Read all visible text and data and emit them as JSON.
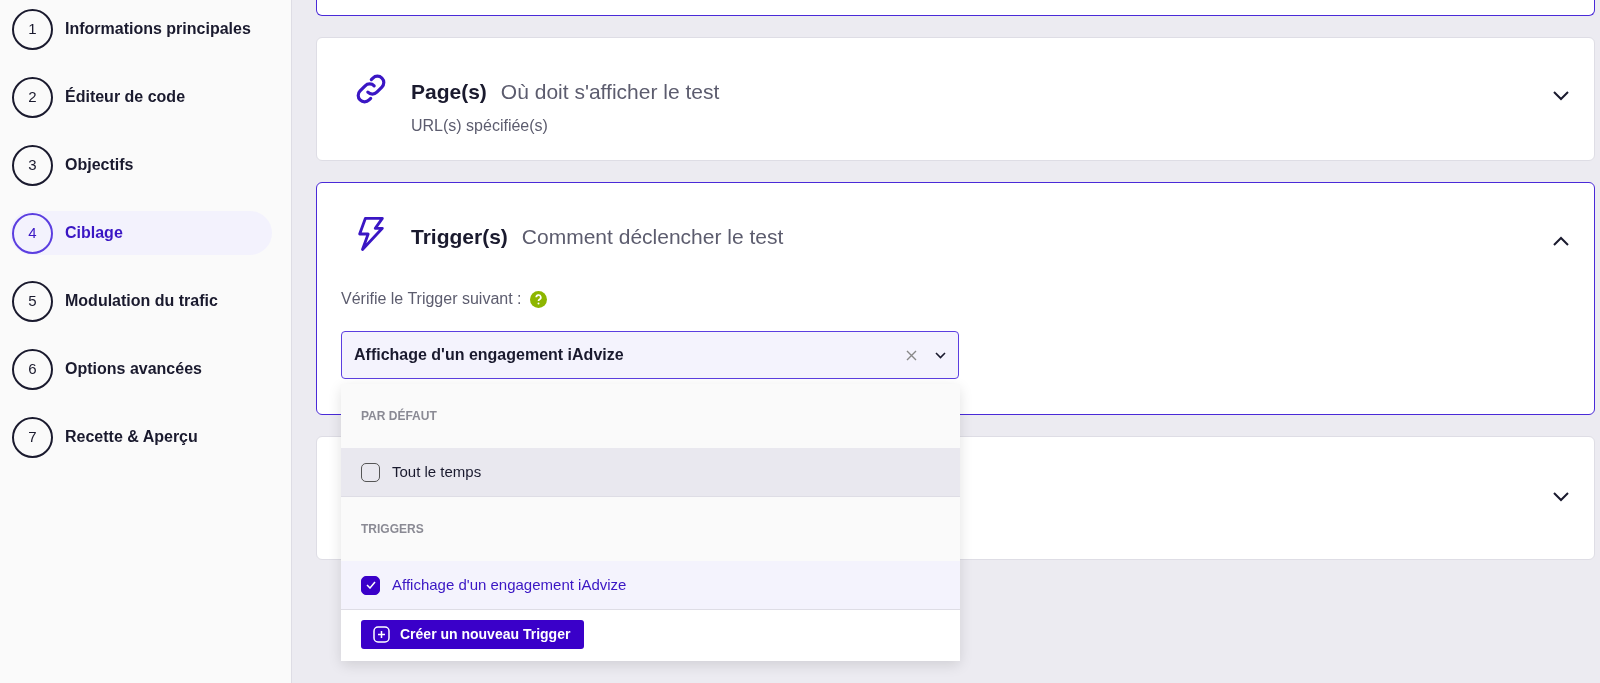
{
  "steps": [
    {
      "number": "1",
      "label": "Informations principales",
      "selected": false
    },
    {
      "number": "2",
      "label": "Éditeur de code",
      "selected": false
    },
    {
      "number": "3",
      "label": "Objectifs",
      "selected": false
    },
    {
      "number": "4",
      "label": "Ciblage",
      "selected": true
    },
    {
      "number": "5",
      "label": "Modulation du trafic",
      "selected": false
    },
    {
      "number": "6",
      "label": "Options avancées",
      "selected": false
    },
    {
      "number": "7",
      "label": "Recette & Aperçu",
      "selected": false
    }
  ],
  "sections": [
    {
      "kind": "link",
      "title": "Page(s)",
      "subtitle": "Où doit s'afficher le test",
      "description": "URL(s) spécifiée(s)",
      "expanded": false
    },
    {
      "kind": "bolt",
      "title": "Trigger(s)",
      "subtitle": "Comment déclencher le test",
      "expanded": true,
      "field_label": "Vérifie le Trigger suivant :",
      "select": {
        "value": "Affichage d'un engagement iAdvize",
        "groups": [
          {
            "heading": "PAR DÉFAUT",
            "options": [
              {
                "label": "Tout le temps",
                "checked": false,
                "highlighted": true
              }
            ]
          },
          {
            "heading": "TRIGGERS",
            "options": [
              {
                "label": "Affichage d'un engagement iAdvize",
                "checked": true,
                "highlighted": false
              }
            ]
          }
        ],
        "create_button": "Créer un nouveau Trigger"
      }
    },
    {
      "expanded": false
    }
  ]
}
